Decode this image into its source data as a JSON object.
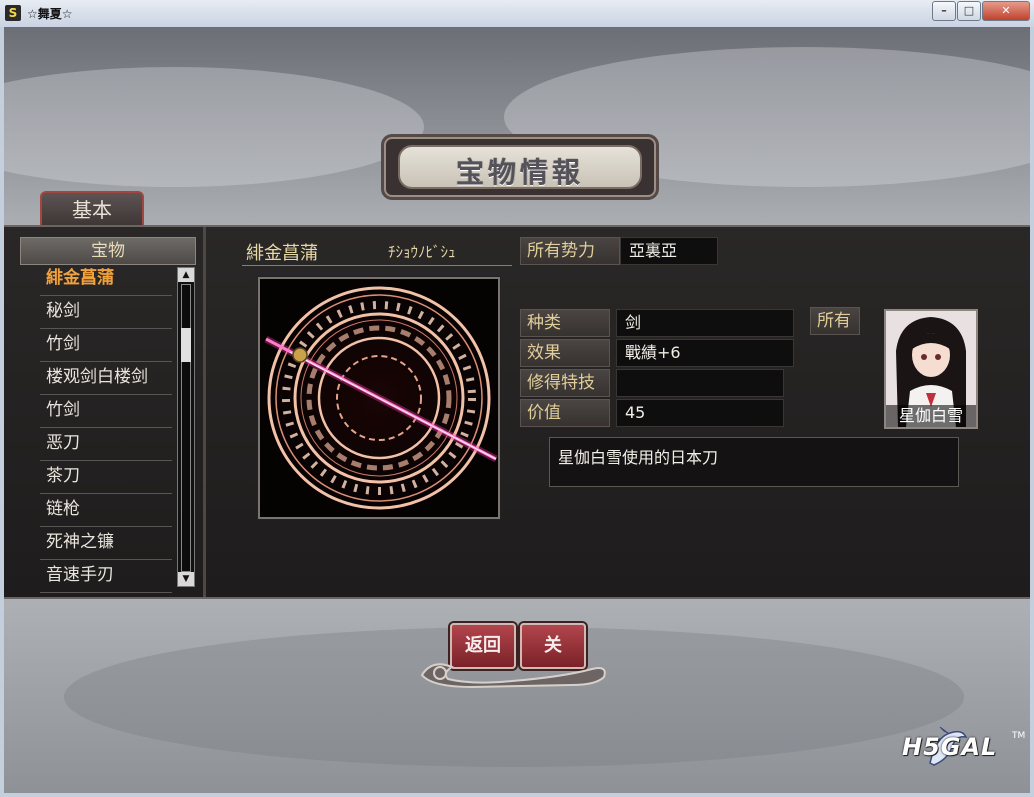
{
  "window": {
    "title": "☆舞夏☆",
    "app_icon": "S",
    "minimize": "–",
    "maximize": "□",
    "close": "✕"
  },
  "screen_title": "宝物情報",
  "tab_basic": "基本",
  "list": {
    "header": "宝物",
    "items": [
      "緋金菖蒲",
      "秘剑",
      "竹剑",
      "楼观剑白楼剑",
      "竹剑",
      "恶刀",
      "茶刀",
      "链枪",
      "死神之镰",
      "音速手刃"
    ],
    "selected_index": 0
  },
  "item": {
    "name": "緋金菖蒲",
    "reading": "ﾁｼｮｳﾉﾋﾞｼｭ",
    "faction_label": "所有势力",
    "faction": "亞裏亞",
    "type_label": "种类",
    "type": "剑",
    "effect_label": "效果",
    "effect": "戰績+6",
    "skill_label": "修得特技",
    "skill": "",
    "value_label": "价值",
    "value": "45",
    "owner_label": "所有",
    "owner_name": "星伽白雪",
    "description": "星伽白雪使用的日本刀"
  },
  "buttons": {
    "back": "返回",
    "close": "关"
  },
  "logo": {
    "text": "H5GAL",
    "tm": "TM"
  }
}
